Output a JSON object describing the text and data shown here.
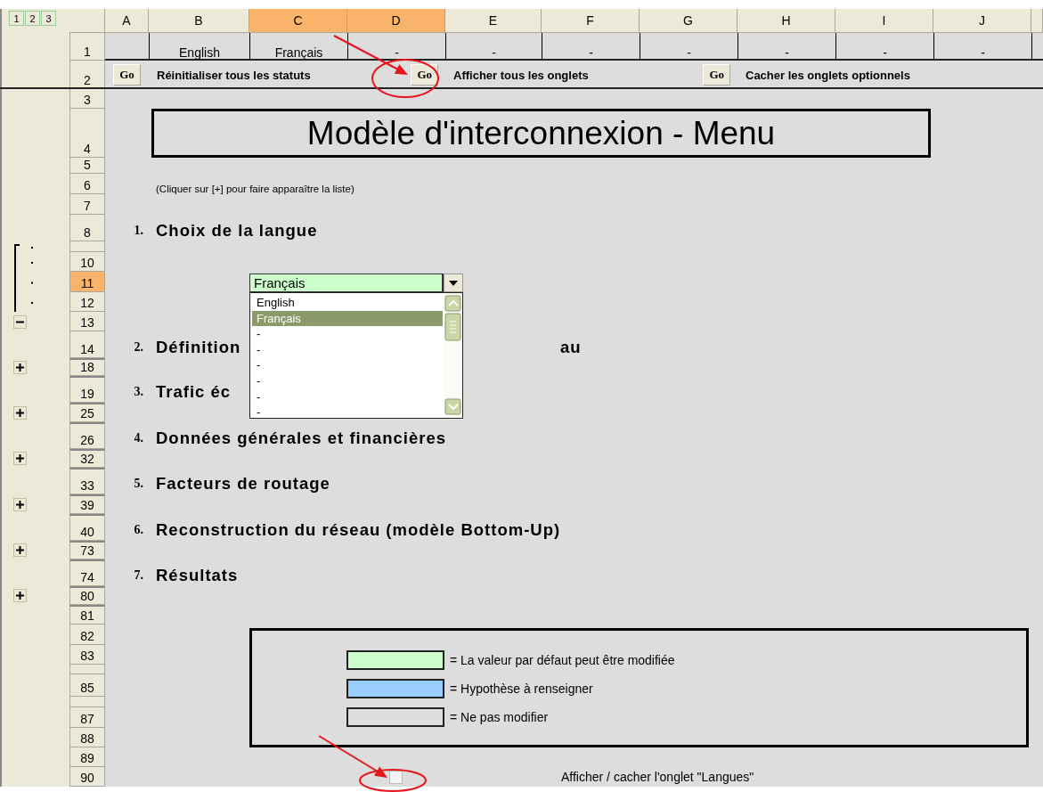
{
  "outline_levels": [
    "1",
    "2",
    "3"
  ],
  "columns": [
    {
      "label": "A",
      "selected": false
    },
    {
      "label": "B",
      "selected": false
    },
    {
      "label": "C",
      "selected": true
    },
    {
      "label": "D",
      "selected": true
    },
    {
      "label": "E",
      "selected": false
    },
    {
      "label": "F",
      "selected": false
    },
    {
      "label": "G",
      "selected": false
    },
    {
      "label": "H",
      "selected": false
    },
    {
      "label": "I",
      "selected": false
    },
    {
      "label": "J",
      "selected": false
    }
  ],
  "rows": [
    {
      "label": "1",
      "selected": false
    },
    {
      "label": "2",
      "selected": false
    },
    {
      "label": "3",
      "selected": false
    },
    {
      "label": "4",
      "selected": false
    },
    {
      "label": "5",
      "selected": false
    },
    {
      "label": "6",
      "selected": false
    },
    {
      "label": "7",
      "selected": false
    },
    {
      "label": "8",
      "selected": false
    },
    {
      "selected": false,
      "kind": "dot"
    },
    {
      "label": "10",
      "selected": false,
      "kind": "dot"
    },
    {
      "label": "11",
      "selected": true,
      "kind": "dot"
    },
    {
      "label": "12",
      "selected": false,
      "kind": "dot"
    },
    {
      "label": "13",
      "selected": false,
      "kind": "minus"
    },
    {
      "label": "14",
      "selected": false
    },
    {
      "label": "18",
      "selected": false,
      "kind": "plus"
    },
    {
      "label": "19",
      "selected": false
    },
    {
      "label": "25",
      "selected": false,
      "kind": "plus"
    },
    {
      "label": "26",
      "selected": false
    },
    {
      "label": "32",
      "selected": false,
      "kind": "plus"
    },
    {
      "label": "33",
      "selected": false
    },
    {
      "label": "39",
      "selected": false,
      "kind": "plus"
    },
    {
      "label": "40",
      "selected": false
    },
    {
      "label": "73",
      "selected": false,
      "kind": "plus"
    },
    {
      "label": "74",
      "selected": false
    },
    {
      "label": "80",
      "selected": false,
      "kind": "plus"
    },
    {
      "label": "81",
      "selected": false
    },
    {
      "label": "82",
      "selected": false
    },
    {
      "label": "83",
      "selected": false
    },
    {
      "selected": false
    },
    {
      "label": "85",
      "selected": false
    },
    {
      "selected": false
    },
    {
      "label": "87",
      "selected": false
    },
    {
      "label": "88",
      "selected": false
    },
    {
      "label": "89",
      "selected": false
    },
    {
      "label": "90",
      "selected": false
    }
  ],
  "language_row": [
    "English",
    "Français",
    "-",
    "-",
    "-",
    "-",
    "-",
    "-",
    "-"
  ],
  "actions": [
    {
      "button": "Go",
      "label": "Réinitialiser tous les statuts"
    },
    {
      "button": "Go",
      "label": "Afficher tous les onglets"
    },
    {
      "button": "Go",
      "label": "Cacher les onglets optionnels"
    }
  ],
  "title": "Modèle d'interconnexion - Menu",
  "hint": "(Cliquer sur [+] pour faire apparaître la liste)",
  "sections": [
    {
      "number": "1.",
      "title": "Choix de la langue"
    },
    {
      "number": "2.",
      "title": "Définition",
      "title_tail": "au"
    },
    {
      "number": "3.",
      "title": "Trafic éc"
    },
    {
      "number": "4.",
      "title": "Données générales et financières"
    },
    {
      "number": "5.",
      "title": "Facteurs de routage"
    },
    {
      "number": "6.",
      "title": "Reconstruction du réseau (modèle Bottom-Up)"
    },
    {
      "number": "7.",
      "title": "Résultats"
    }
  ],
  "language_dropdown": {
    "value": "Français",
    "expanded": true,
    "options": [
      {
        "label": "English",
        "selected": false
      },
      {
        "label": "Français",
        "selected": true
      },
      {
        "label": "-",
        "selected": false
      },
      {
        "label": "-",
        "selected": false
      },
      {
        "label": "-",
        "selected": false
      },
      {
        "label": "-",
        "selected": false
      },
      {
        "label": "-",
        "selected": false
      },
      {
        "label": "-",
        "selected": false
      }
    ]
  },
  "legend": [
    {
      "color": "#ccffcc",
      "text": "= La valeur par défaut peut être modifiée"
    },
    {
      "color": "#99ccff",
      "text": "= Hypothèse à renseigner"
    },
    {
      "color": "#dddddd",
      "text": "= Ne pas modifier"
    }
  ],
  "tabs_toggle": {
    "checked": false,
    "label": "Afficher / cacher l'onglet \"Langues\""
  }
}
